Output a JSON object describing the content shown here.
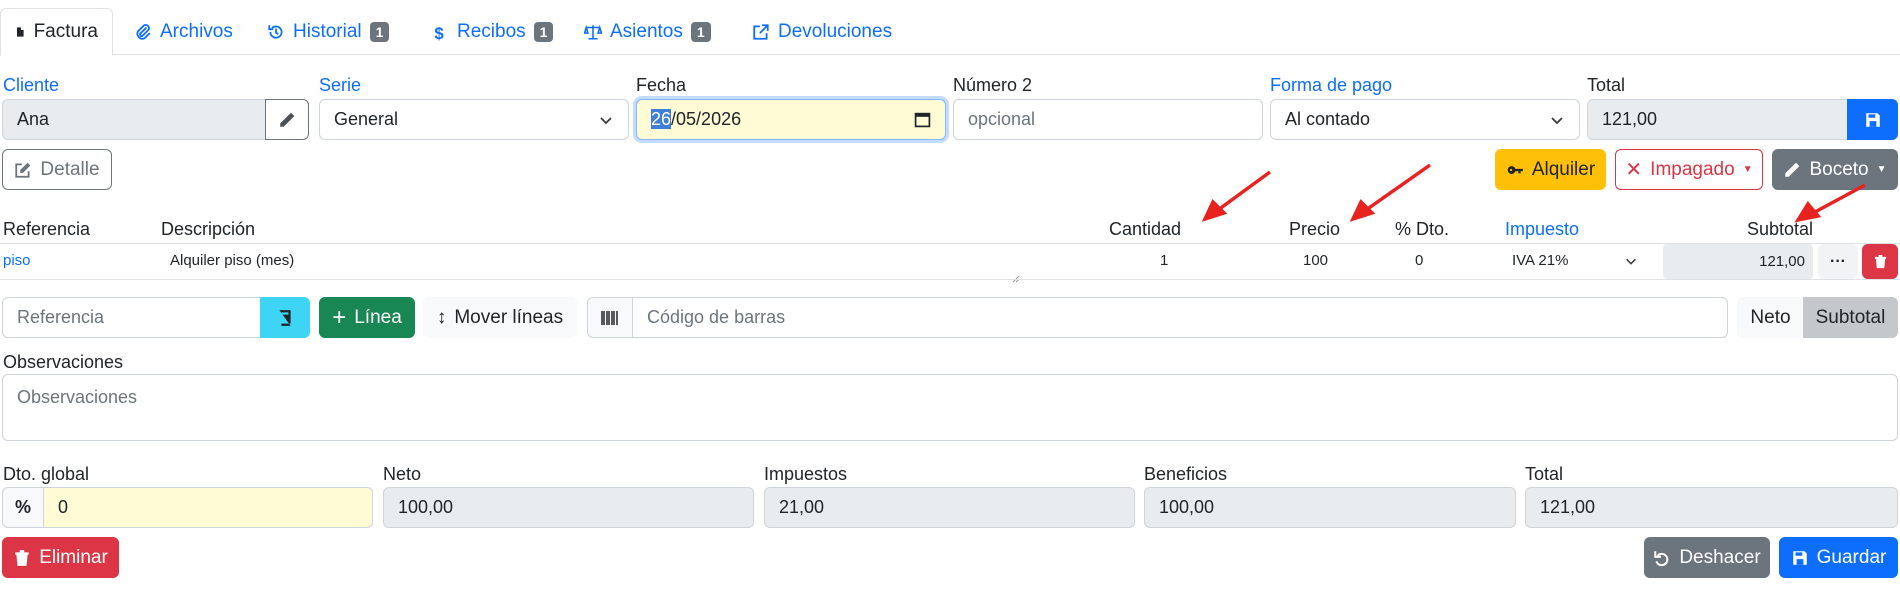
{
  "tabs": [
    {
      "label": "Factura",
      "icon": "file-icon",
      "badge": ""
    },
    {
      "label": "Archivos",
      "icon": "paperclip-icon",
      "badge": ""
    },
    {
      "label": "Historial",
      "icon": "history-icon",
      "badge": "1"
    },
    {
      "label": "Recibos",
      "icon": "dollar-icon",
      "badge": "1"
    },
    {
      "label": "Asientos",
      "icon": "balance-scale-icon",
      "badge": "1"
    },
    {
      "label": "Devoluciones",
      "icon": "share-icon",
      "badge": ""
    }
  ],
  "header": {
    "cliente_label": "Cliente",
    "cliente_value": "Ana",
    "serie_label": "Serie",
    "serie_value": "General",
    "fecha_label": "Fecha",
    "fecha_day": "26",
    "fecha_rest": "/05/2026",
    "numero2_label": "Número 2",
    "numero2_placeholder": "opcional",
    "forma_pago_label": "Forma de pago",
    "forma_pago_value": "Al contado",
    "total_label": "Total",
    "total_value": "121,00"
  },
  "actions": {
    "detalle": "Detalle",
    "alquiler": "Alquiler",
    "impagado": "Impagado",
    "boceto": "Boceto"
  },
  "lines": {
    "headers": {
      "referencia": "Referencia",
      "descripcion": "Descripción",
      "cantidad": "Cantidad",
      "precio": "Precio",
      "dto": "% Dto.",
      "impuesto": "Impuesto",
      "subtotal": "Subtotal"
    },
    "rows": [
      {
        "referencia": "piso",
        "descripcion": "Alquiler piso (mes)",
        "cantidad": "1",
        "precio": "100",
        "dto": "0",
        "impuesto": "IVA 21%",
        "subtotal": "121,00"
      }
    ]
  },
  "toolbar": {
    "referencia_placeholder": "Referencia",
    "linea": "Línea",
    "mover_lineas": "Mover líneas",
    "codigo_barras_placeholder": "Código de barras",
    "neto": "Neto",
    "subtotal": "Subtotal"
  },
  "observaciones": {
    "label": "Observaciones",
    "placeholder": "Observaciones"
  },
  "totals": {
    "dto_global_label": "Dto. global",
    "dto_global_value": "0",
    "neto_label": "Neto",
    "neto_value": "100,00",
    "impuestos_label": "Impuestos",
    "impuestos_value": "21,00",
    "beneficios_label": "Beneficios",
    "beneficios_value": "100,00",
    "total_label": "Total",
    "total_value": "121,00"
  },
  "footer": {
    "eliminar": "Eliminar",
    "deshacer": "Deshacer",
    "guardar": "Guardar"
  },
  "colors": {
    "primary": "#0d6efd",
    "danger": "#dc3545",
    "warning": "#ffc107",
    "success": "#198754",
    "secondary": "#6c757d",
    "info": "#3dd5f3",
    "annotation_arrow": "#e8221f"
  }
}
